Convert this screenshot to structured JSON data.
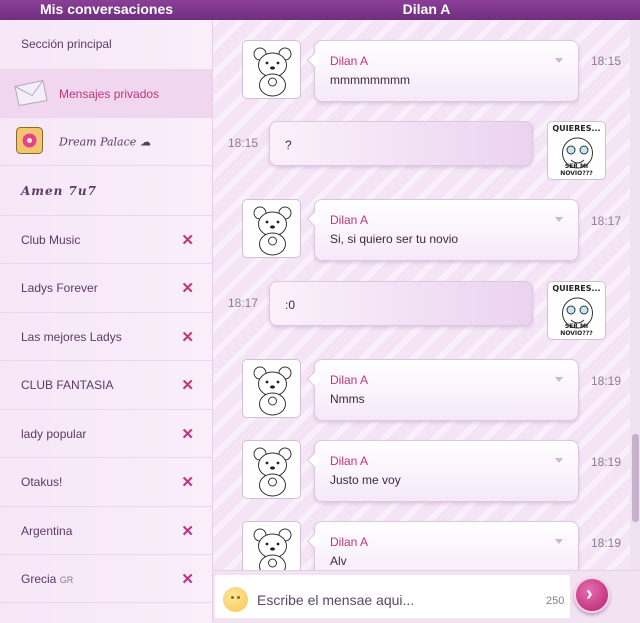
{
  "header": {
    "left_title": "Mis conversaciones",
    "right_title": "Dilan A"
  },
  "sidebar": {
    "items": [
      {
        "label": "Sección principal",
        "closable": false
      },
      {
        "label": "Mensajes privados",
        "closable": false,
        "active": true,
        "icon": "envelope-icon"
      },
      {
        "label": "Dream Palace ☁",
        "closable": false,
        "icon": "flower-icon"
      },
      {
        "label": "Amen 7u7",
        "closable": false
      },
      {
        "label": "Club Music",
        "closable": true
      },
      {
        "label": "Ladys Forever",
        "closable": true
      },
      {
        "label": "Las mejores Ladys",
        "closable": true
      },
      {
        "label": "CLUB FANTASIA",
        "closable": true
      },
      {
        "label": "lady popular",
        "closable": true
      },
      {
        "label": "Otakus!",
        "closable": true
      },
      {
        "label": "Argentina",
        "closable": true
      },
      {
        "label": "Grecia",
        "suffix": "GR",
        "closable": true
      }
    ],
    "close_glyph": "✕"
  },
  "messages": [
    {
      "direction": "in",
      "name": "Dilan A",
      "text": "mmmmmmmm",
      "time": "18:15"
    },
    {
      "direction": "out",
      "text": "?",
      "time": "18:15"
    },
    {
      "direction": "in",
      "name": "Dilan A",
      "text": "Si, si quiero ser tu novio",
      "time": "18:17"
    },
    {
      "direction": "out",
      "text": ":0",
      "time": "18:17"
    },
    {
      "direction": "in",
      "name": "Dilan A",
      "text": "Nmms",
      "time": "18:19"
    },
    {
      "direction": "in",
      "name": "Dilan A",
      "text": "Justo me voy",
      "time": "18:19"
    },
    {
      "direction": "in",
      "name": "Dilan A",
      "text": "Alv",
      "time": "18:19"
    }
  ],
  "meme": {
    "top": "QUIERES...",
    "bottom": "SER MI NOVIO???"
  },
  "composer": {
    "placeholder": "Escribe el mensae aqui...",
    "char_count": "250",
    "send_glyph": "›"
  },
  "colors": {
    "accent": "#c2337e",
    "header": "#7a348a"
  }
}
